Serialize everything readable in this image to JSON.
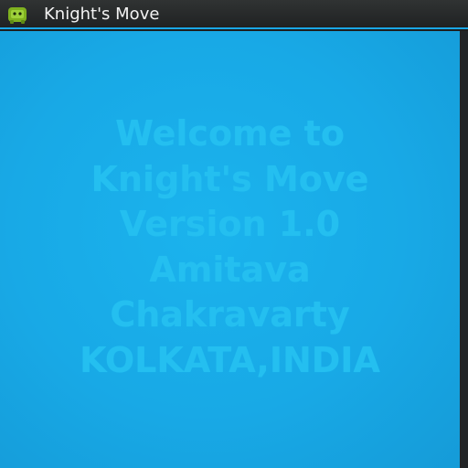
{
  "titlebar": {
    "app_title": "Knight's Move",
    "icon": "android-app-icon"
  },
  "welcome": {
    "lines": [
      "Welcome to",
      "Knight's Move",
      "Version 1.0",
      "Amitava",
      "Chakravarty",
      "KOLKATA,INDIA"
    ]
  },
  "colors": {
    "titlebar_bg": "#2a2c2d",
    "title_text": "#f3f3f3",
    "content_bg": "#18a9e6",
    "welcome_text": "#24bff0"
  }
}
